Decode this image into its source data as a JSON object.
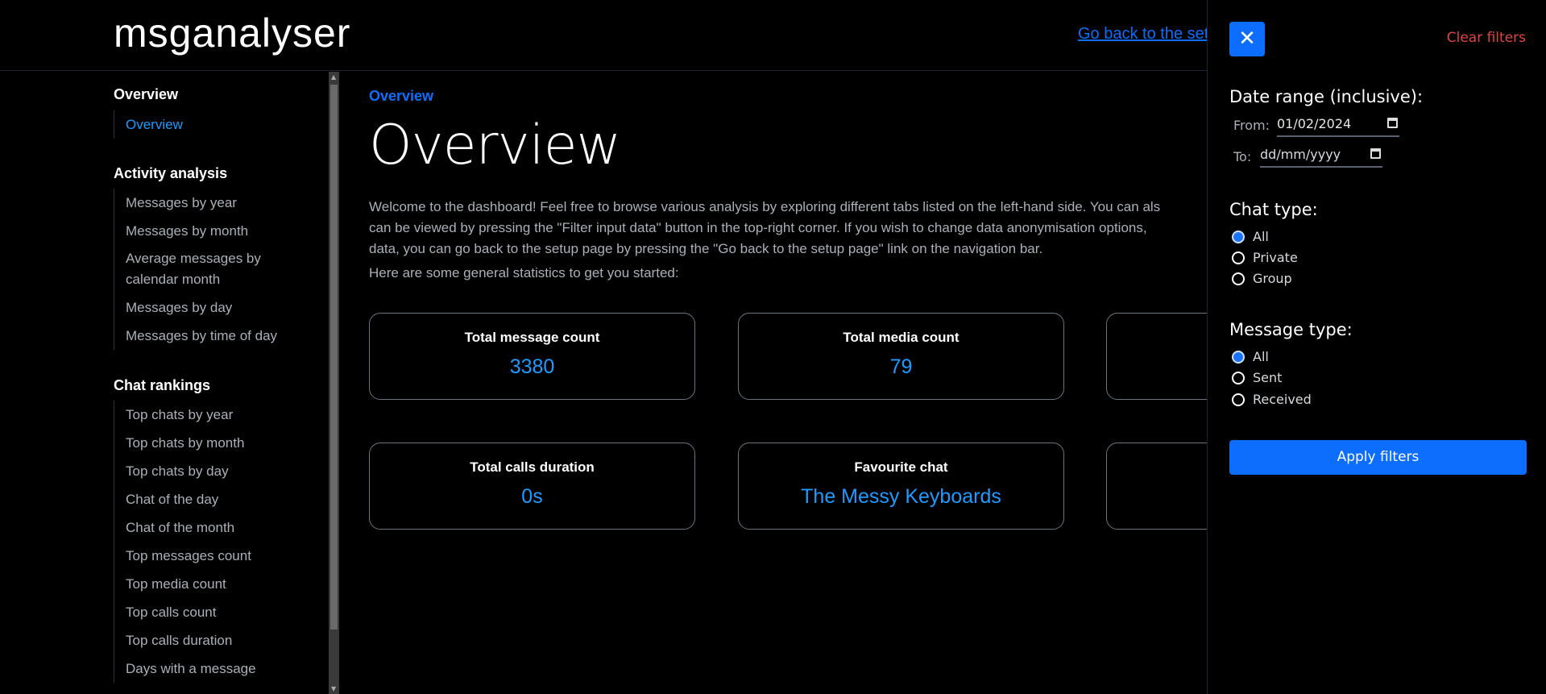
{
  "header": {
    "logo": "msganalyser",
    "go_back_link": "Go back to the setup page"
  },
  "sidebar": {
    "sections": [
      {
        "heading": "Overview",
        "items": [
          "Overview"
        ]
      },
      {
        "heading": "Activity analysis",
        "items": [
          "Messages by year",
          "Messages by month",
          "Average messages by calendar month",
          "Messages by day",
          "Messages by time of day"
        ]
      },
      {
        "heading": "Chat rankings",
        "items": [
          "Top chats by year",
          "Top chats by month",
          "Top chats by day",
          "Chat of the day",
          "Chat of the month",
          "Top messages count",
          "Top media count",
          "Top calls count",
          "Top calls duration",
          "Days with a message"
        ]
      }
    ],
    "active_item": "Overview"
  },
  "main": {
    "breadcrumb": "Overview",
    "title": "Overview",
    "intro_lines": [
      "Welcome to the dashboard! Feel free to browse various analysis by exploring different tabs listed on the left-hand side. You can als",
      "can be viewed by pressing the \"Filter input data\" button in the top-right corner. If you wish to change data anonymisation options,",
      "data, you can go back to the setup page by pressing the \"Go back to the setup page\" link on the navigation bar."
    ],
    "stats_intro": "Here are some general statistics to get you started:",
    "cards": [
      {
        "title": "Total message count",
        "value": "3380"
      },
      {
        "title": "Total media count",
        "value": "79"
      },
      {
        "title": "Total calls duration",
        "value": "0s"
      },
      {
        "title": "Favourite chat",
        "value": "The Messy Keyboards"
      }
    ]
  },
  "filters": {
    "clear_label": "Clear filters",
    "date_range_label": "Date range (inclusive):",
    "from_label": "From:",
    "from_value": "01/02/2024",
    "to_label": "To:",
    "to_placeholder": "dd/mm/yyyy",
    "chat_type_label": "Chat type:",
    "chat_types": [
      "All",
      "Private",
      "Group"
    ],
    "chat_type_selected": "All",
    "message_type_label": "Message type:",
    "message_types": [
      "All",
      "Sent",
      "Received"
    ],
    "message_type_selected": "All",
    "apply_label": "Apply filters"
  },
  "colors": {
    "accent": "#0d6efd",
    "value": "#1e9bff",
    "danger": "#e0443f"
  }
}
